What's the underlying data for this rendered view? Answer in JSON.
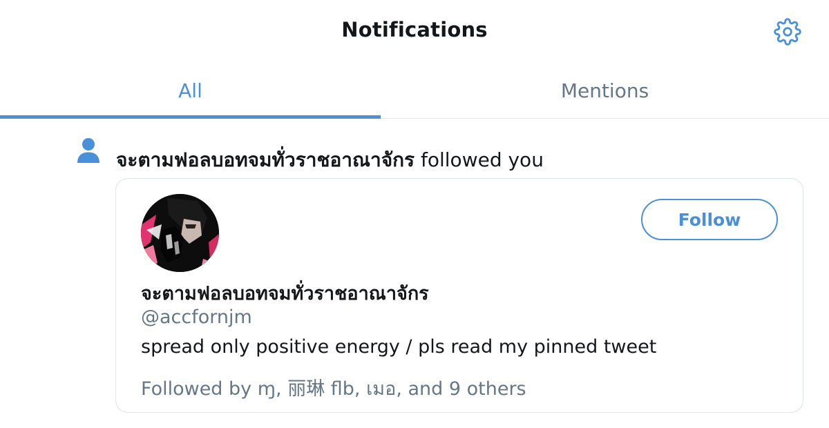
{
  "header": {
    "title": "Notifications",
    "settings_icon": "gear-icon"
  },
  "tabs": [
    {
      "label": "All",
      "active": true
    },
    {
      "label": "Mentions",
      "active": false
    }
  ],
  "colors": {
    "accent": "#4a90d9",
    "text_primary": "#14171a",
    "text_secondary": "#657786",
    "border": "#e1e8ed"
  },
  "notification": {
    "type_icon": "person-icon",
    "actor_name": "จะตามฟอลบอทจมทั่วราชอาณาจักร",
    "action_text": " followed you",
    "card": {
      "display_name": "จะตามฟอลบอทจมทั่วราชอาณาจักร",
      "handle": "@accfornjm",
      "bio": "spread only positive energy / pls read my pinned tweet",
      "followed_by": "Followed by ɱ, 丽琳 flb, เมอ, and 9 others",
      "follow_button_label": "Follow"
    }
  }
}
